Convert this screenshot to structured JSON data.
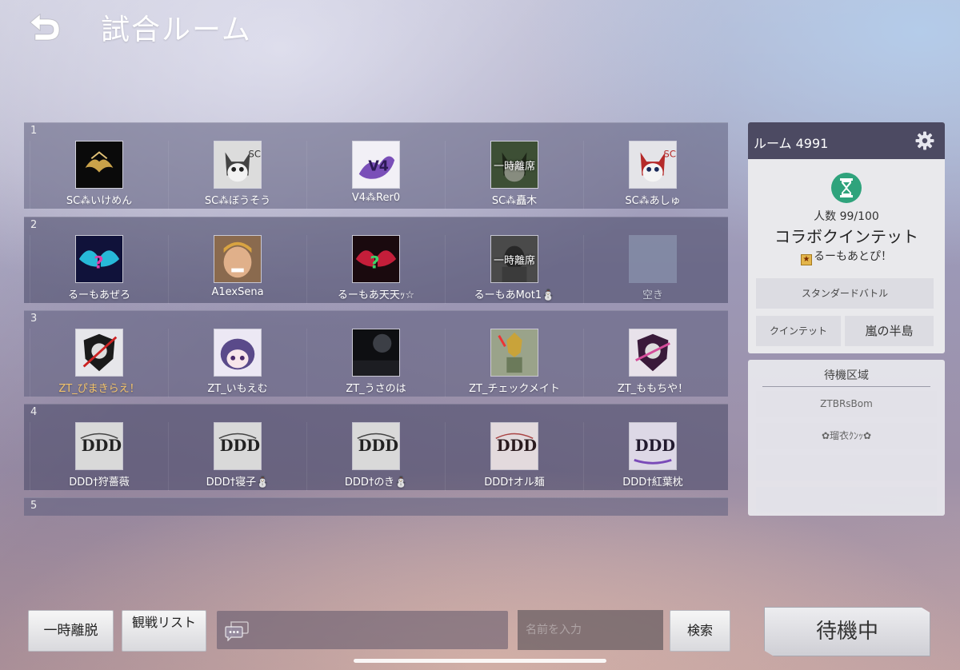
{
  "header": {
    "title": "試合ルーム"
  },
  "teams": [
    {
      "number": "1",
      "players": [
        {
          "name": "SC⁂いけめん",
          "avatar": "gold-wolf-logo-on-black",
          "status": ""
        },
        {
          "name": "SC⁂ぼうそう",
          "avatar": "gray-fox-mascot",
          "status": ""
        },
        {
          "name": "V4⁂Rer0",
          "avatar": "purple-splash-v4-logo",
          "status": ""
        },
        {
          "name": "SC⁂矗木",
          "avatar": "green-fox-mascot",
          "status": "一時離席"
        },
        {
          "name": "SC⁂あしゅ",
          "avatar": "red-fox-mascot",
          "status": ""
        }
      ]
    },
    {
      "number": "2",
      "players": [
        {
          "name": "るーもあぜろ",
          "avatar": "cyan-winged-logo",
          "status": ""
        },
        {
          "name": "A1exSena",
          "avatar": "face-photo",
          "status": ""
        },
        {
          "name": "るーもあ天天ｯ☆",
          "avatar": "red-winged-logo",
          "status": ""
        },
        {
          "name": "るーもあMot1⛄",
          "avatar": "portrait-photo",
          "status": "一時離席"
        },
        {
          "name": "空き",
          "avatar": "empty-slot",
          "status": ""
        }
      ]
    },
    {
      "number": "3",
      "players": [
        {
          "name": "ZT_ぴまきらえ！",
          "avatar": "lion-shield-logo",
          "status": "",
          "highlight": true
        },
        {
          "name": "ZT_いもえむ",
          "avatar": "anime-character",
          "status": ""
        },
        {
          "name": "ZT_うさのは",
          "avatar": "dark-moon-scene",
          "status": ""
        },
        {
          "name": "ZT_チェックメイト",
          "avatar": "armored-warrior",
          "status": ""
        },
        {
          "name": "ZT_ももちや！",
          "avatar": "lion-shield-logo-pink",
          "status": ""
        }
      ]
    },
    {
      "number": "4",
      "players": [
        {
          "name": "DDD†狩薔薇",
          "avatar": "ddd-gothic-logo",
          "status": ""
        },
        {
          "name": "DDD†寝子⛄",
          "avatar": "ddd-gothic-logo",
          "status": ""
        },
        {
          "name": "DDD†のき⛄",
          "avatar": "ddd-gothic-logo",
          "status": ""
        },
        {
          "name": "DDD†オル麺",
          "avatar": "ddd-gothic-logo-pink",
          "status": ""
        },
        {
          "name": "DDD†紅葉枕",
          "avatar": "ddd-gothic-logo-purple",
          "status": ""
        }
      ]
    },
    {
      "number": "5",
      "players": []
    }
  ],
  "room": {
    "id_label": "ルーム 4991",
    "count": "人数 99/100",
    "name": "コラボクインテット",
    "owner": "るーもあとぴ！",
    "mode": "スタンダードバトル",
    "format": "クインテット",
    "map": "嵐の半島"
  },
  "waiting_area": {
    "title": "待機区域",
    "members": [
      "ZTBRsBom",
      "✿瑠衣ｸﾝｯ✿",
      "",
      ""
    ]
  },
  "footer": {
    "leave_label": "一時離脱",
    "spectate_label": "観戦リスト",
    "search_placeholder": "名前を入力",
    "search_label": "検索",
    "status_button": "待機中"
  },
  "colors": {
    "accent_gold": "#f3c36a",
    "room_header": "#4c4a62",
    "hourglass": "#2fa37c"
  }
}
